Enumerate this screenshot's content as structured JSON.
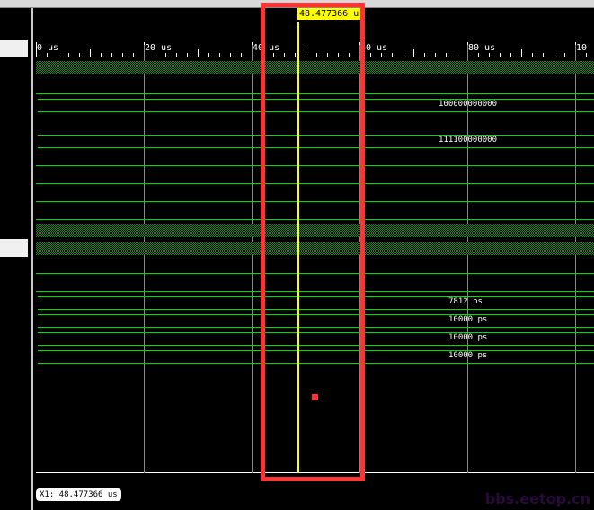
{
  "timeline": {
    "unit": "us",
    "labels": [
      "0 us",
      "20 us",
      "40 us",
      "60 us",
      "80 us",
      "10"
    ],
    "label_times": [
      0,
      20,
      40,
      60,
      80,
      100
    ]
  },
  "cursor": {
    "time_us": 48.477366,
    "label": "48.477366 u",
    "readout": "X1: 48.477366 us"
  },
  "signals": [
    {
      "type": "hatch"
    },
    {
      "type": "low"
    },
    {
      "type": "bus",
      "value": "100000000000"
    },
    {
      "type": "bus",
      "value": "111100000000"
    },
    {
      "type": "low"
    },
    {
      "type": "low"
    },
    {
      "type": "low"
    },
    {
      "type": "low"
    },
    {
      "type": "hatch"
    },
    {
      "type": "hatch"
    },
    {
      "type": "low"
    },
    {
      "type": "low"
    },
    {
      "type": "bus",
      "value": "7812 ps"
    },
    {
      "type": "bus",
      "value": "10000 ps"
    },
    {
      "type": "bus",
      "value": "10000 ps"
    },
    {
      "type": "bus",
      "value": "10000 ps"
    }
  ],
  "watermark": "bbs.eetop.cn",
  "colors": {
    "signal": "#00e000",
    "cursor": "#ffff00",
    "highlight": "#ff3333"
  }
}
